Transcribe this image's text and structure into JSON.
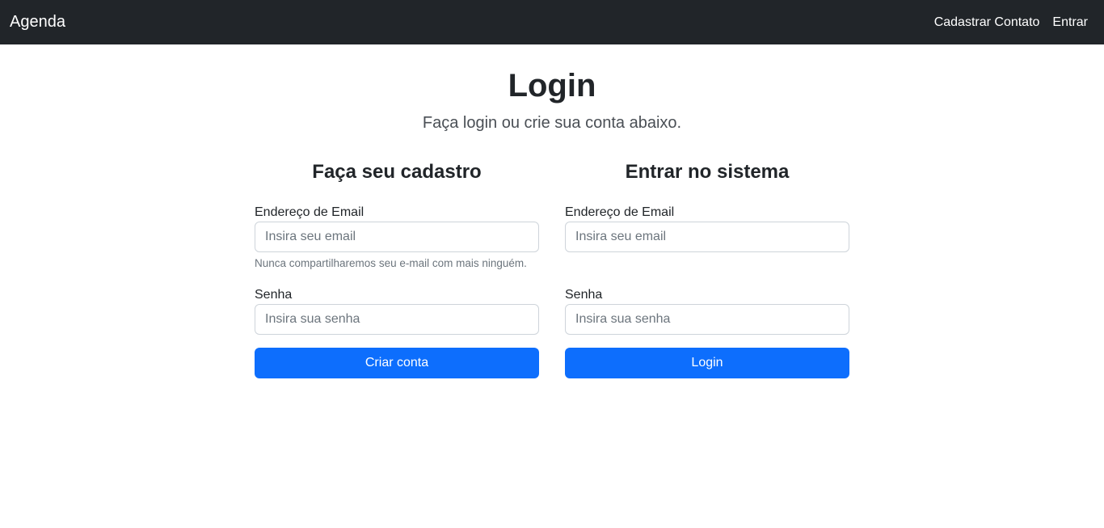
{
  "navbar": {
    "brand": "Agenda",
    "links": [
      "Cadastrar Contato",
      "Entrar"
    ]
  },
  "header": {
    "title": "Login",
    "subtitle": "Faça login ou crie sua conta abaixo."
  },
  "signup": {
    "title": "Faça seu cadastro",
    "email_label": "Endereço de Email",
    "email_placeholder": "Insira seu email",
    "email_help": "Nunca compartilharemos seu e-mail com mais ninguém.",
    "password_label": "Senha",
    "password_placeholder": "Insira sua senha",
    "submit_label": "Criar conta"
  },
  "login": {
    "title": "Entrar no sistema",
    "email_label": "Endereço de Email",
    "email_placeholder": "Insira seu email",
    "password_label": "Senha",
    "password_placeholder": "Insira sua senha",
    "submit_label": "Login"
  },
  "colors": {
    "navbar_bg": "#212529",
    "primary": "#0d6efd"
  }
}
